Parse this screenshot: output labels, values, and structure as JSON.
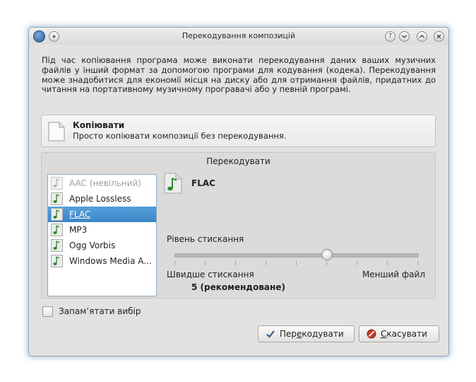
{
  "window": {
    "title": "Перекодування композицій",
    "help_label": "?",
    "description": "Під час копіювання програма може виконати перекодування даних ваших музичних файлів у інший формат за допомогою програми для кодування (кодека). Перекодування може знадобитися для економії місця на диску або для отримання файлів, придатних до читання на портативному музичному програвачі або у певній програмі."
  },
  "copy_option": {
    "title": "Копіювати",
    "subtitle": "Просто копіювати композиції без перекодування."
  },
  "transcode": {
    "title": "Перекодувати",
    "formats": [
      {
        "label": "AAC (невільний)",
        "enabled": false,
        "selected": false
      },
      {
        "label": "Apple Lossless",
        "enabled": true,
        "selected": false
      },
      {
        "label": "FLAC",
        "enabled": true,
        "selected": true
      },
      {
        "label": "MP3",
        "enabled": true,
        "selected": false
      },
      {
        "label": "Ogg Vorbis",
        "enabled": true,
        "selected": false
      },
      {
        "label": "Windows Media A...",
        "enabled": true,
        "selected": false
      }
    ],
    "selected_codec": "FLAC",
    "compression": {
      "label": "Рівень стискання",
      "min_label": "Швидше стискання",
      "max_label": "Менший файл",
      "value_text": "5 (рекомендоване)",
      "value": 5,
      "min": 0,
      "max": 8
    }
  },
  "remember": {
    "label": "Запам’ятати вибір",
    "checked": false
  },
  "buttons": {
    "transcode_pre": "Пер",
    "transcode_mnemonic": "е",
    "transcode_post": "кодувати",
    "cancel_pre": "",
    "cancel_mnemonic": "С",
    "cancel_post": "касувати"
  },
  "colors": {
    "selection": "#3b85c6",
    "note_icon": "#2e8b2e",
    "cancel_icon": "#c0392b"
  }
}
